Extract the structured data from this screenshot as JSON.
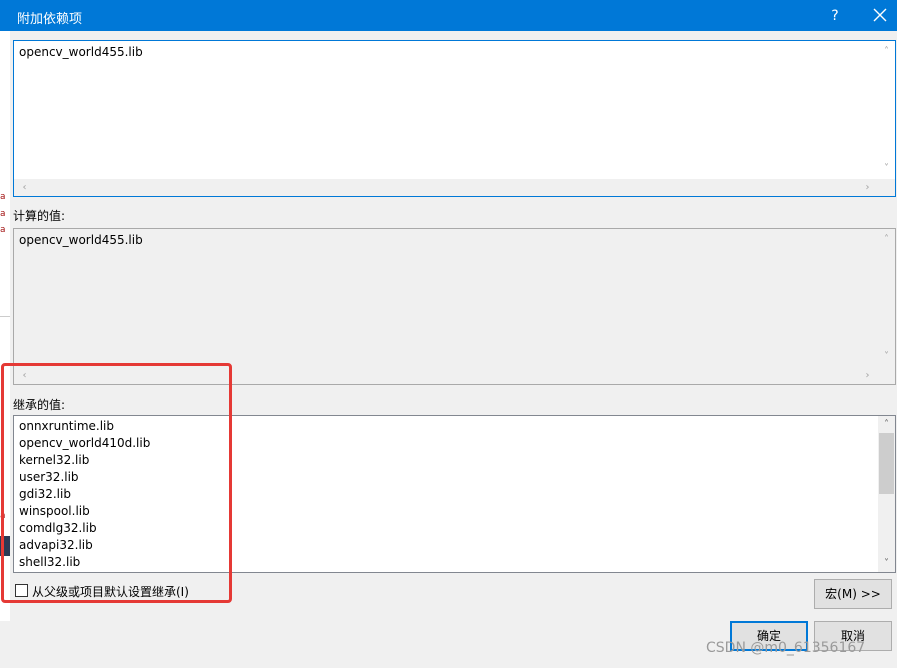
{
  "window": {
    "title": "附加依赖项",
    "help_label": "?"
  },
  "editor": {
    "value": "opencv_world455.lib"
  },
  "evaluated": {
    "label": "计算的值:",
    "value": "opencv_world455.lib"
  },
  "inherited": {
    "label": "继承的值:",
    "items": [
      "onnxruntime.lib",
      "opencv_world410d.lib",
      "kernel32.lib",
      "user32.lib",
      "gdi32.lib",
      "winspool.lib",
      "comdlg32.lib",
      "advapi32.lib",
      "shell32.lib"
    ]
  },
  "inherit_checkbox": {
    "label": "从父级或项目默认设置继承(I)",
    "checked": false
  },
  "buttons": {
    "macro": "宏(M) >>",
    "ok": "确定",
    "cancel": "取消"
  },
  "watermark": "CSDN @m0_61356167",
  "side_marks": [
    "a",
    "a",
    "a",
    "a"
  ],
  "colors": {
    "titlebar": "#0078d7",
    "highlight_frame": "#e53935"
  }
}
